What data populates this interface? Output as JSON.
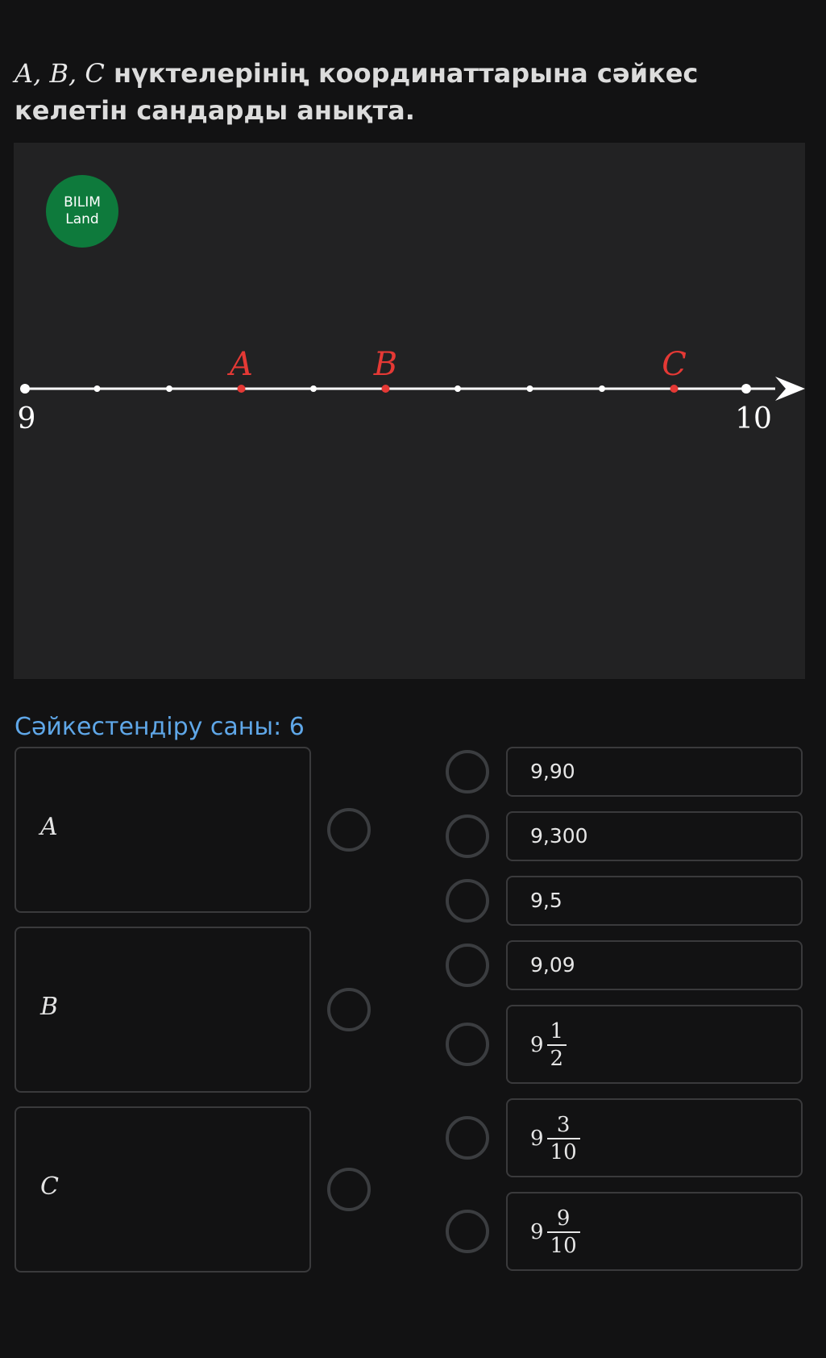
{
  "question": {
    "math_prefix": "A, B, C",
    "text": " нүктелерінің координаттарына сәйкес келетін сандарды анықта."
  },
  "figure": {
    "logo_line1": "BILIM",
    "logo_line2": "Land",
    "number_line": {
      "start_label": "9",
      "end_label": "10",
      "divisions": 10,
      "line_color": "#ffffff",
      "point_color": "#e53935",
      "points": [
        {
          "label": "A",
          "value": 9.3
        },
        {
          "label": "B",
          "value": 9.5
        },
        {
          "label": "C",
          "value": 9.9
        }
      ]
    }
  },
  "match_count_text": "Сәйкестендіру саны: 6",
  "left_items": [
    {
      "label": "A"
    },
    {
      "label": "B"
    },
    {
      "label": "C"
    }
  ],
  "right_items": [
    {
      "type": "text",
      "text": "9,90"
    },
    {
      "type": "text",
      "text": "9,300"
    },
    {
      "type": "text",
      "text": "9,5"
    },
    {
      "type": "text",
      "text": "9,09"
    },
    {
      "type": "fraction",
      "whole": "9",
      "num": "1",
      "den": "2"
    },
    {
      "type": "fraction",
      "whole": "9",
      "num": "3",
      "den": "10"
    },
    {
      "type": "fraction",
      "whole": "9",
      "num": "9",
      "den": "10"
    }
  ]
}
